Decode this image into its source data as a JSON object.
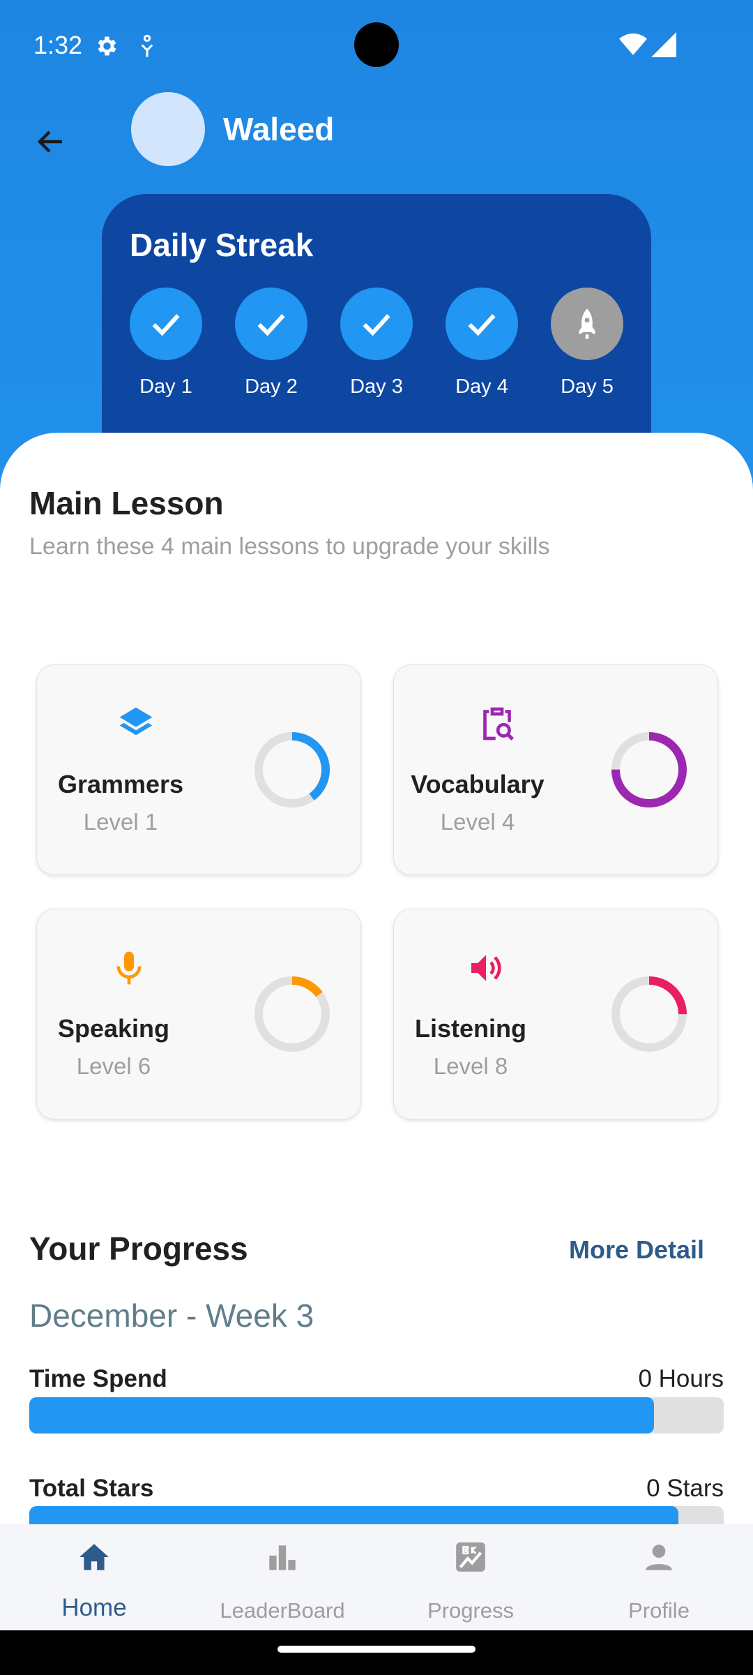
{
  "status_bar": {
    "time": "1:32"
  },
  "header": {
    "user_name": "Waleed"
  },
  "streak": {
    "title": "Daily Streak",
    "days": [
      {
        "label": "Day 1",
        "done": true
      },
      {
        "label": "Day 2",
        "done": true
      },
      {
        "label": "Day 3",
        "done": true
      },
      {
        "label": "Day 4",
        "done": true
      },
      {
        "label": "Day 5",
        "done": false
      }
    ]
  },
  "main_lesson": {
    "title": "Main Lesson",
    "subtitle": "Learn these 4 main lessons to upgrade your skills",
    "lessons": [
      {
        "name": "Grammers",
        "level": "Level 1",
        "icon": "layers-icon",
        "color": "#2196F3",
        "progress": 0.4
      },
      {
        "name": "Vocabulary",
        "level": "Level 4",
        "icon": "clipboard-search-icon",
        "color": "#9C27B0",
        "progress": 0.75
      },
      {
        "name": "Speaking",
        "level": "Level 6",
        "icon": "microphone-icon",
        "color": "#FF9800",
        "progress": 0.15
      },
      {
        "name": "Listening",
        "level": "Level 8",
        "icon": "speaker-icon",
        "color": "#E91E63",
        "progress": 0.25
      }
    ]
  },
  "progress": {
    "title": "Your Progress",
    "more_detail": "More Detail",
    "period": "December - Week 3",
    "metrics": [
      {
        "label": "Time Spend",
        "value": "0 Hours",
        "fill": 0.9
      },
      {
        "label": "Total Stars",
        "value": "0 Stars",
        "fill": 0.935
      }
    ]
  },
  "bottom_nav": {
    "items": [
      {
        "label": "Home",
        "icon": "home-icon",
        "active": true
      },
      {
        "label": "LeaderBoard",
        "icon": "leaderboard-icon",
        "active": false
      },
      {
        "label": "Progress",
        "icon": "progress-chart-icon",
        "active": false
      },
      {
        "label": "Profile",
        "icon": "person-icon",
        "active": false
      }
    ]
  },
  "colors": {
    "header": "#1E86E2",
    "streak_card": "#0E47A1",
    "accent": "#2196F3",
    "nav_active": "#2E5C8A"
  }
}
